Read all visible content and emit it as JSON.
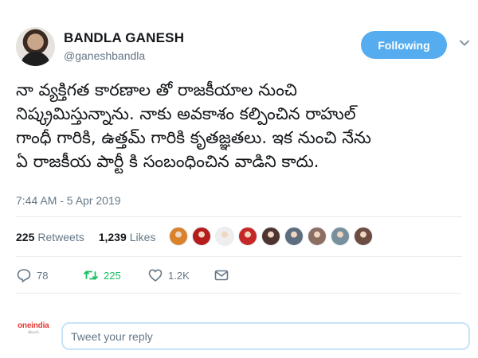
{
  "header": {
    "name": "BANDLA GANESH",
    "handle": "@ganeshbandla",
    "follow_label": "Following"
  },
  "tweet": {
    "lines": [
      "నా వ్యక్తిగత కారణాల తో రాజకీయాల నుంచి",
      "నిష్క్రమిస్తున్నాను. నాకు అవకాశం కల్పించిన రాహుల్",
      "గాంధీ గారికి, ఉత్తమ్ గారికి కృతజ్ఞతలు. ఇక నుంచి నేను",
      "ఏ రాజకీయ పార్టీ కి సంబంధించిన వాడిని కాదు."
    ],
    "timestamp": "7:44 AM - 5 Apr 2019"
  },
  "stats": {
    "retweets_count": "225",
    "retweets_label": "Retweets",
    "likes_count": "1,239",
    "likes_label": "Likes"
  },
  "likers": [
    {
      "color": "#d9822b"
    },
    {
      "color": "#b71c1c"
    },
    {
      "color": "#eeeeee"
    },
    {
      "color": "#c62828"
    },
    {
      "color": "#4e342e"
    },
    {
      "color": "#5d6d7e"
    },
    {
      "color": "#8d6e63"
    },
    {
      "color": "#78909c"
    },
    {
      "color": "#6d4c41"
    }
  ],
  "actions": {
    "replies": "78",
    "retweets": "225",
    "likes": "1.2K"
  },
  "reply": {
    "placeholder": "Tweet your reply",
    "logo_text": "oneindia",
    "logo_sub": "తెలుగు"
  },
  "colors": {
    "accent": "#55acee",
    "retweet_green": "#17bf63",
    "muted": "#657786"
  }
}
